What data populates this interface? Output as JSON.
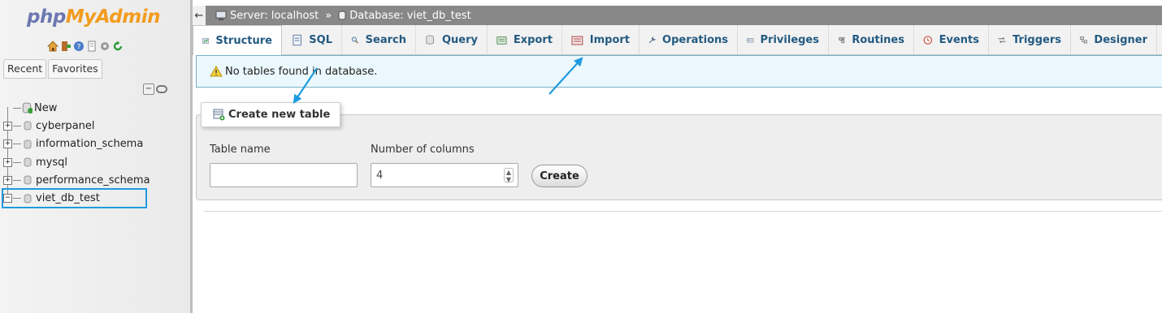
{
  "logo": {
    "part1": "php",
    "part2": "MyAdmin"
  },
  "nav": {
    "quick_icons": [
      "home-icon",
      "exit-icon",
      "help-icon",
      "docs-icon",
      "settings-icon",
      "reload-icon"
    ],
    "tabs": [
      "Recent",
      "Favorites"
    ],
    "tree": [
      {
        "label": "New",
        "expander": "",
        "type": "new"
      },
      {
        "label": "cyberpanel",
        "expander": "+",
        "type": "db"
      },
      {
        "label": "information_schema",
        "expander": "+",
        "type": "db"
      },
      {
        "label": "mysql",
        "expander": "+",
        "type": "db"
      },
      {
        "label": "performance_schema",
        "expander": "+",
        "type": "db"
      },
      {
        "label": "viet_db_test",
        "expander": "−",
        "type": "db",
        "selected": true
      }
    ]
  },
  "breadcrumb": {
    "back": "←",
    "server": "Server: localhost",
    "separator": "»",
    "database": "Database: viet_db_test"
  },
  "tabs": [
    {
      "label": "Structure",
      "icon": "structure-icon",
      "active": true
    },
    {
      "label": "SQL",
      "icon": "sql-icon"
    },
    {
      "label": "Search",
      "icon": "search-icon"
    },
    {
      "label": "Query",
      "icon": "query-icon"
    },
    {
      "label": "Export",
      "icon": "export-icon"
    },
    {
      "label": "Import",
      "icon": "import-icon"
    },
    {
      "label": "Operations",
      "icon": "wrench-icon"
    },
    {
      "label": "Privileges",
      "icon": "privileges-icon"
    },
    {
      "label": "Routines",
      "icon": "routines-icon"
    },
    {
      "label": "Events",
      "icon": "events-icon"
    },
    {
      "label": "Triggers",
      "icon": "triggers-icon"
    },
    {
      "label": "Designer",
      "icon": "designer-icon"
    }
  ],
  "notice": {
    "text": "No tables found in database."
  },
  "create_table": {
    "legend": "Create new table",
    "table_name_label": "Table name",
    "table_name_value": "",
    "columns_label": "Number of columns",
    "columns_value": "4",
    "create_button": "Create"
  },
  "colors": {
    "accent_tab_text": "#235a81",
    "breadcrumb_bg": "#888888",
    "notice_bg": "#ebf8fd",
    "annotation_blue": "#1f9be0"
  }
}
